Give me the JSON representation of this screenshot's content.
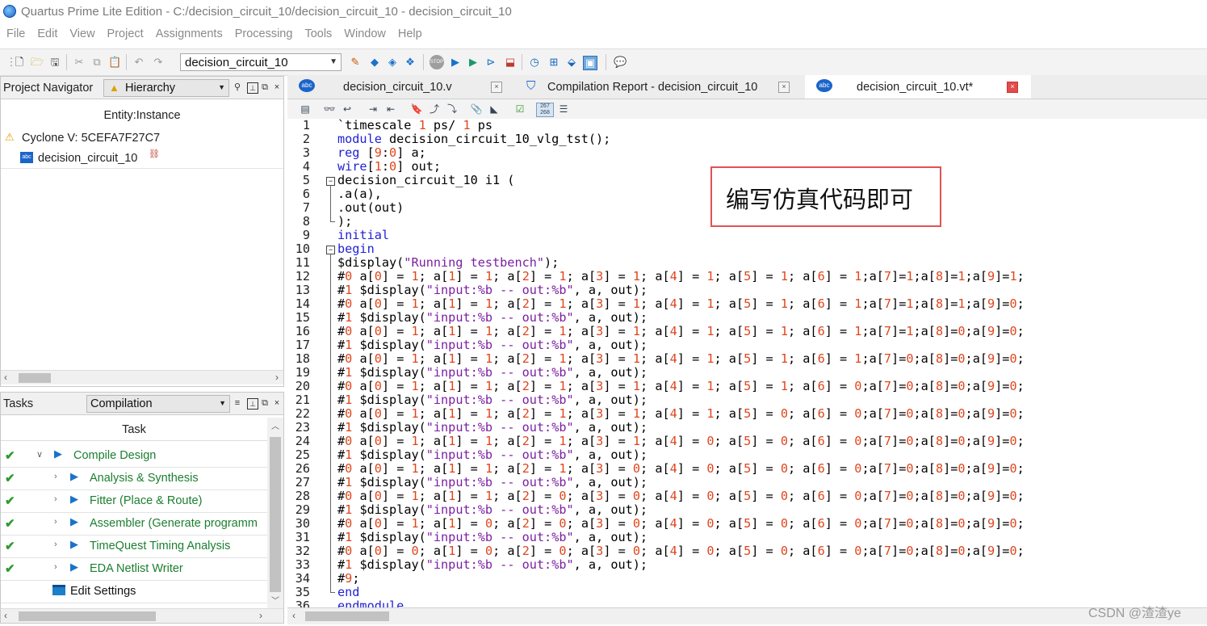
{
  "window": {
    "title": "Quartus Prime Lite Edition - C:/decision_circuit_10/decision_circuit_10 - decision_circuit_10"
  },
  "menu": [
    "File",
    "Edit",
    "View",
    "Project",
    "Assignments",
    "Processing",
    "Tools",
    "Window",
    "Help"
  ],
  "toolbar": {
    "project_select": "decision_circuit_10"
  },
  "navigator": {
    "label": "Project Navigator",
    "mode": "Hierarchy",
    "column_header": "Entity:Instance",
    "device": "Cyclone V: 5CEFA7F27C7",
    "top_entity": "decision_circuit_10"
  },
  "tasks": {
    "label": "Tasks",
    "flow": "Compilation",
    "column_header": "Task",
    "items": [
      {
        "label": "Compile Design",
        "done": true
      },
      {
        "label": "Analysis & Synthesis",
        "done": true
      },
      {
        "label": "Fitter (Place & Route)",
        "done": true
      },
      {
        "label": "Assembler (Generate programm",
        "done": true
      },
      {
        "label": "TimeQuest Timing Analysis",
        "done": true
      },
      {
        "label": "EDA Netlist Writer",
        "done": true
      },
      {
        "label": "Edit Settings",
        "done": false
      }
    ]
  },
  "tabs": [
    {
      "label": "decision_circuit_10.v",
      "active": false
    },
    {
      "label": "Compilation Report - decision_circuit_10",
      "active": false
    },
    {
      "label": "decision_circuit_10.vt*",
      "active": true
    }
  ],
  "editor": {
    "lines": [
      "`timescale 1 ps/ 1 ps",
      "module decision_circuit_10_vlg_tst();",
      "reg [9:0] a;",
      "wire[1:0] out;",
      "decision_circuit_10 i1 (",
      ".a(a),",
      ".out(out)",
      ");",
      "initial",
      "begin",
      "$display(\"Running testbench\");",
      "#0 a[0] = 1; a[1] = 1; a[2] = 1; a[3] = 1; a[4] = 1; a[5] = 1; a[6] = 1;a[7]=1;a[8]=1;a[9]=1;",
      "#1 $display(\"input:%b -- out:%b\", a, out);",
      "#0 a[0] = 1; a[1] = 1; a[2] = 1; a[3] = 1; a[4] = 1; a[5] = 1; a[6] = 1;a[7]=1;a[8]=1;a[9]=0;",
      "#1 $display(\"input:%b -- out:%b\", a, out);",
      "#0 a[0] = 1; a[1] = 1; a[2] = 1; a[3] = 1; a[4] = 1; a[5] = 1; a[6] = 1;a[7]=1;a[8]=0;a[9]=0;",
      "#1 $display(\"input:%b -- out:%b\", a, out);",
      "#0 a[0] = 1; a[1] = 1; a[2] = 1; a[3] = 1; a[4] = 1; a[5] = 1; a[6] = 1;a[7]=0;a[8]=0;a[9]=0;",
      "#1 $display(\"input:%b -- out:%b\", a, out);",
      "#0 a[0] = 1; a[1] = 1; a[2] = 1; a[3] = 1; a[4] = 1; a[5] = 1; a[6] = 0;a[7]=0;a[8]=0;a[9]=0;",
      "#1 $display(\"input:%b -- out:%b\", a, out);",
      "#0 a[0] = 1; a[1] = 1; a[2] = 1; a[3] = 1; a[4] = 1; a[5] = 0; a[6] = 0;a[7]=0;a[8]=0;a[9]=0;",
      "#1 $display(\"input:%b -- out:%b\", a, out);",
      "#0 a[0] = 1; a[1] = 1; a[2] = 1; a[3] = 1; a[4] = 0; a[5] = 0; a[6] = 0;a[7]=0;a[8]=0;a[9]=0;",
      "#1 $display(\"input:%b -- out:%b\", a, out);",
      "#0 a[0] = 1; a[1] = 1; a[2] = 1; a[3] = 0; a[4] = 0; a[5] = 0; a[6] = 0;a[7]=0;a[8]=0;a[9]=0;",
      "#1 $display(\"input:%b -- out:%b\", a, out);",
      "#0 a[0] = 1; a[1] = 1; a[2] = 0; a[3] = 0; a[4] = 0; a[5] = 0; a[6] = 0;a[7]=0;a[8]=0;a[9]=0;",
      "#1 $display(\"input:%b -- out:%b\", a, out);",
      "#0 a[0] = 1; a[1] = 0; a[2] = 0; a[3] = 0; a[4] = 0; a[5] = 0; a[6] = 0;a[7]=0;a[8]=0;a[9]=0;",
      "#1 $display(\"input:%b -- out:%b\", a, out);",
      "#0 a[0] = 0; a[1] = 0; a[2] = 0; a[3] = 0; a[4] = 0; a[5] = 0; a[6] = 0;a[7]=0;a[8]=0;a[9]=0;",
      "#1 $display(\"input:%b -- out:%b\", a, out);",
      "#9;",
      "end",
      "endmodule"
    ]
  },
  "annotation": "编写仿真代码即可",
  "watermark": "CSDN @渣渣ye",
  "colors": {
    "keyword": "#1f1fd6",
    "number": "#e0461c",
    "string": "#7b1fa2",
    "task_text": "#1b7f2f",
    "check": "#2e9a2e",
    "annotation_border": "#e25252"
  }
}
